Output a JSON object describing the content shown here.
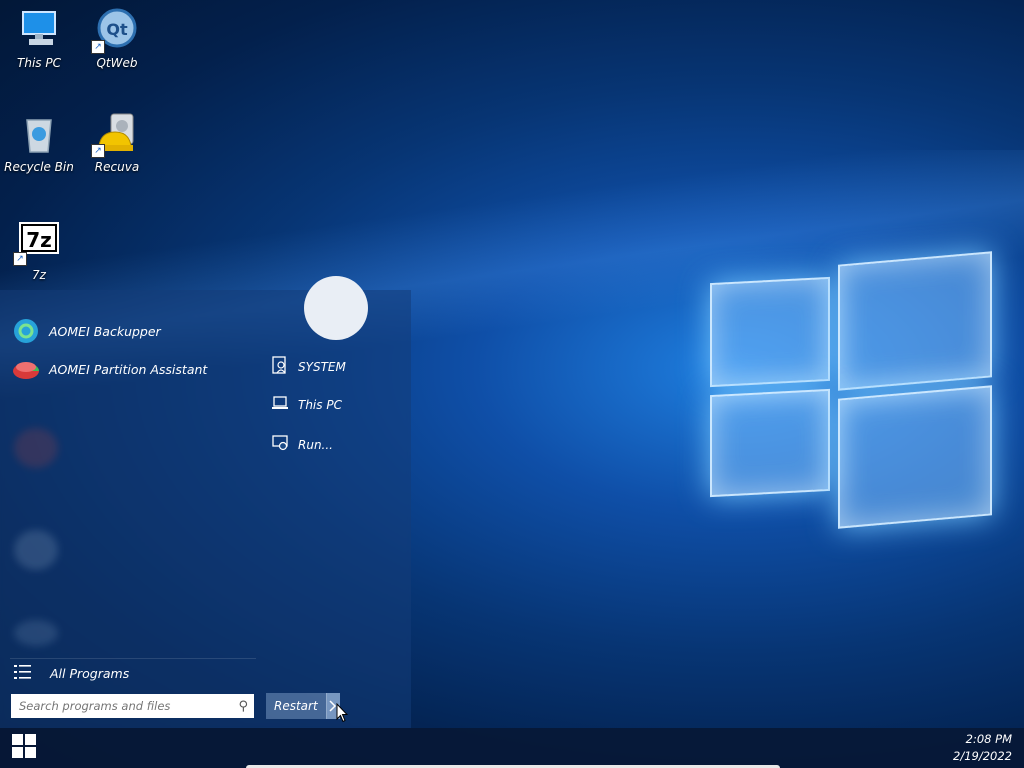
{
  "desktop": {
    "icons": [
      {
        "label": "This PC",
        "icon": "computer-icon"
      },
      {
        "label": "QtWeb",
        "icon": "qtweb-icon"
      },
      {
        "label": "Recycle Bin",
        "icon": "recycle-bin-icon"
      },
      {
        "label": "Recuva",
        "icon": "recuva-icon"
      },
      {
        "label": "7z",
        "icon": "7zip-icon"
      }
    ]
  },
  "start_menu": {
    "programs": [
      {
        "label": "AOMEI Backupper",
        "icon": "aomei-backupper-icon"
      },
      {
        "label": "AOMEI Partition Assistant",
        "icon": "aomei-partition-icon"
      }
    ],
    "all_programs_label": "All Programs",
    "search": {
      "placeholder": "Search programs and files",
      "value": ""
    },
    "restart_label": "Restart",
    "right_items": [
      {
        "label": "SYSTEM",
        "icon": "user-folder-icon"
      },
      {
        "label": "This PC",
        "icon": "laptop-icon"
      },
      {
        "label": "Run...",
        "icon": "run-icon"
      }
    ]
  },
  "taskbar": {
    "time": "2:08 PM",
    "date": "2/19/2022"
  },
  "colors": {
    "wallpaper_dark": "#021634",
    "wallpaper_light": "#1f7fe0",
    "start_menu": "#143c78",
    "taskbar": "#061836"
  }
}
